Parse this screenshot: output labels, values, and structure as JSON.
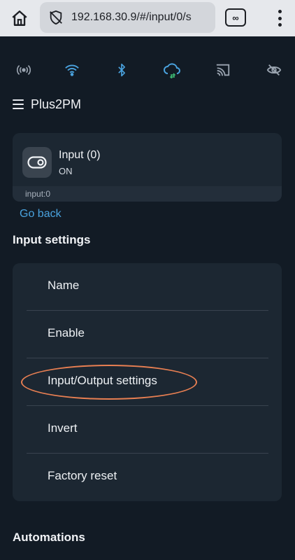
{
  "browser": {
    "url": "192.168.30.9/#/input/0/s",
    "tabs_label": "∞"
  },
  "colors": {
    "accent": "#4aa3df",
    "wifi": "#4aa3df",
    "cloud_arrows": "#3cb371",
    "highlight": "#e87f52"
  },
  "status_icons": [
    "broadcast-icon",
    "wifi-icon",
    "bluetooth-icon",
    "cloud-sync-icon",
    "cast-icon",
    "eye-off-icon"
  ],
  "device": {
    "title": "Plus2PM"
  },
  "input_card": {
    "name": "Input (0)",
    "state": "ON",
    "id_label": "input:0"
  },
  "go_back": "Go back",
  "input_settings": {
    "title": "Input settings",
    "items": [
      {
        "label": "Name"
      },
      {
        "label": "Enable"
      },
      {
        "label": "Input/Output settings"
      },
      {
        "label": "Invert"
      },
      {
        "label": "Factory reset"
      }
    ]
  },
  "automations": {
    "title": "Automations"
  }
}
